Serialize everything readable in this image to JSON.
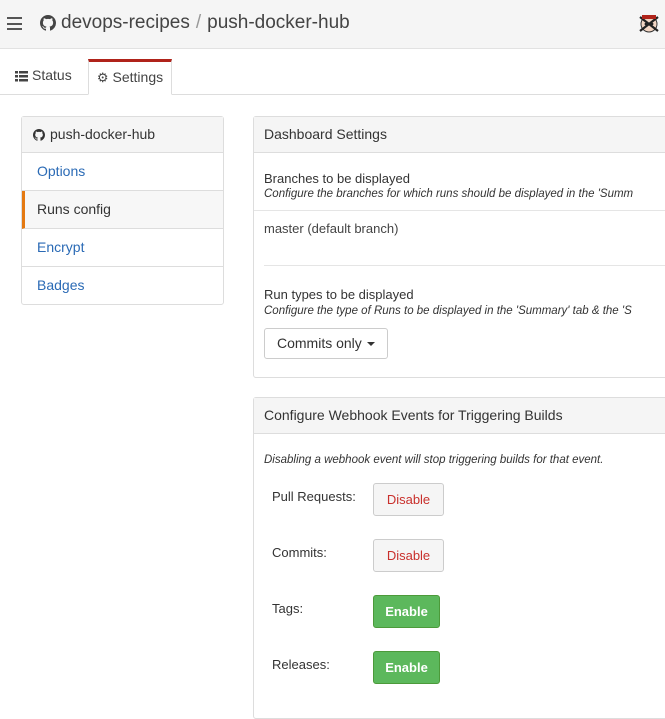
{
  "header": {
    "org": "devops-recipes",
    "separator": "/",
    "repo": "push-docker-hub"
  },
  "tabs": [
    {
      "label": "Status",
      "icon": "list-icon",
      "active": false
    },
    {
      "label": "Settings",
      "icon": "gear-icon",
      "active": true
    }
  ],
  "sidebar": {
    "title": "push-docker-hub",
    "items": [
      {
        "label": "Options"
      },
      {
        "label": "Runs config"
      },
      {
        "label": "Encrypt"
      },
      {
        "label": "Badges"
      }
    ],
    "active_index": 1
  },
  "dashboard": {
    "title": "Dashboard Settings",
    "branches_title": "Branches to be displayed",
    "branches_desc": "Configure the branches for which runs should be displayed in the 'Summ",
    "branch_value": "master (default branch)",
    "run_types_title": "Run types to be displayed",
    "run_types_desc": "Configure the type of Runs to be displayed in the 'Summary' tab & the 'S",
    "run_types_value": "Commits only"
  },
  "webhook": {
    "title": "Configure Webhook Events for Triggering Builds",
    "desc": "Disabling a webhook event will stop triggering builds for that event.",
    "events": [
      {
        "label": "Pull Requests:",
        "button": "Disable",
        "state": "enabled"
      },
      {
        "label": "Commits:",
        "button": "Disable",
        "state": "enabled"
      },
      {
        "label": "Tags:",
        "button": "Enable",
        "state": "disabled"
      },
      {
        "label": "Releases:",
        "button": "Enable",
        "state": "disabled"
      }
    ]
  },
  "colors": {
    "accent_tab": "#b0231a",
    "active_sidebar_bar": "#e47911",
    "link": "#2a6ab5",
    "enable_green": "#5cb85c",
    "disable_red": "#c9302c"
  }
}
